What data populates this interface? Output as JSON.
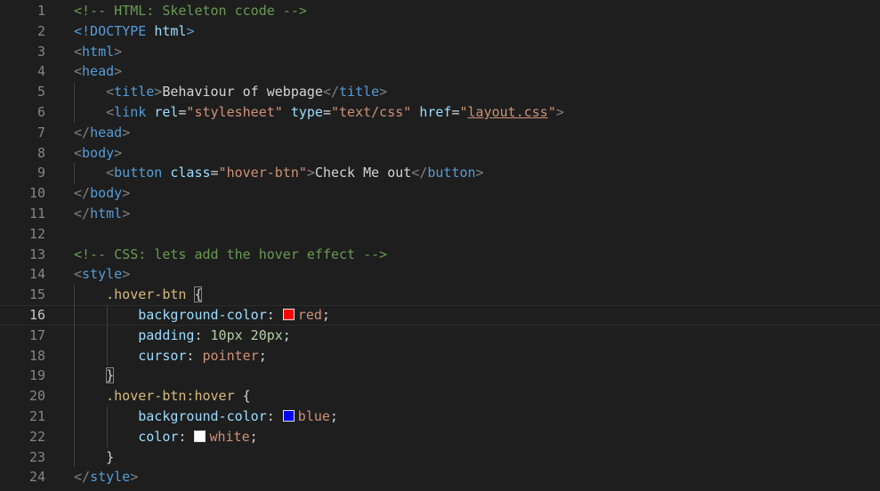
{
  "colors": {
    "background": "#1e1e1e",
    "line_number": "#858585",
    "comment": "#6a9955",
    "tag": "#569cd6",
    "attribute": "#9cdcfe",
    "string": "#ce9178",
    "selector": "#d7ba7d",
    "number": "#b5cea8"
  },
  "lines": [
    {
      "n": "1",
      "tokens": [
        {
          "t": "<!-- HTML: Skeleton ccode -->",
          "k": "comment"
        }
      ]
    },
    {
      "n": "2",
      "tokens": [
        {
          "t": "<!DOCTYPE ",
          "k": "tag"
        },
        {
          "t": "html",
          "k": "attr"
        },
        {
          "t": ">",
          "k": "tag"
        }
      ]
    },
    {
      "n": "3",
      "tokens": [
        {
          "t": "<",
          "k": "punct"
        },
        {
          "t": "html",
          "k": "tag"
        },
        {
          "t": ">",
          "k": "punct"
        }
      ]
    },
    {
      "n": "4",
      "tokens": [
        {
          "t": "<",
          "k": "punct"
        },
        {
          "t": "head",
          "k": "tag"
        },
        {
          "t": ">",
          "k": "punct"
        }
      ]
    },
    {
      "n": "5",
      "indent": 1,
      "tokens": [
        {
          "t": "<",
          "k": "punct"
        },
        {
          "t": "title",
          "k": "tag"
        },
        {
          "t": ">",
          "k": "punct"
        },
        {
          "t": "Behaviour of webpage",
          "k": "text"
        },
        {
          "t": "</",
          "k": "punct"
        },
        {
          "t": "title",
          "k": "tag"
        },
        {
          "t": ">",
          "k": "punct"
        }
      ]
    },
    {
      "n": "6",
      "indent": 1,
      "tokens": [
        {
          "t": "<",
          "k": "punct"
        },
        {
          "t": "link",
          "k": "tag"
        },
        {
          "t": " ",
          "k": "text"
        },
        {
          "t": "rel",
          "k": "attr"
        },
        {
          "t": "=",
          "k": "text"
        },
        {
          "t": "\"stylesheet\"",
          "k": "str"
        },
        {
          "t": " ",
          "k": "text"
        },
        {
          "t": "type",
          "k": "attr"
        },
        {
          "t": "=",
          "k": "text"
        },
        {
          "t": "\"text/css\"",
          "k": "str"
        },
        {
          "t": " ",
          "k": "text"
        },
        {
          "t": "href",
          "k": "attr"
        },
        {
          "t": "=",
          "k": "text"
        },
        {
          "t": "\"",
          "k": "str"
        },
        {
          "t": "layout.css",
          "k": "str",
          "link": true
        },
        {
          "t": "\"",
          "k": "str"
        },
        {
          "t": ">",
          "k": "punct"
        }
      ]
    },
    {
      "n": "7",
      "tokens": [
        {
          "t": "</",
          "k": "punct"
        },
        {
          "t": "head",
          "k": "tag"
        },
        {
          "t": ">",
          "k": "punct"
        }
      ]
    },
    {
      "n": "8",
      "tokens": [
        {
          "t": "<",
          "k": "punct"
        },
        {
          "t": "body",
          "k": "tag"
        },
        {
          "t": ">",
          "k": "punct"
        }
      ]
    },
    {
      "n": "9",
      "indent": 1,
      "tokens": [
        {
          "t": "<",
          "k": "punct"
        },
        {
          "t": "button",
          "k": "tag"
        },
        {
          "t": " ",
          "k": "text"
        },
        {
          "t": "class",
          "k": "attr"
        },
        {
          "t": "=",
          "k": "text"
        },
        {
          "t": "\"hover-btn\"",
          "k": "str"
        },
        {
          "t": ">",
          "k": "punct"
        },
        {
          "t": "Check Me out",
          "k": "text"
        },
        {
          "t": "</",
          "k": "punct"
        },
        {
          "t": "button",
          "k": "tag"
        },
        {
          "t": ">",
          "k": "punct"
        }
      ]
    },
    {
      "n": "10",
      "tokens": [
        {
          "t": "</",
          "k": "punct"
        },
        {
          "t": "body",
          "k": "tag"
        },
        {
          "t": ">",
          "k": "punct"
        }
      ]
    },
    {
      "n": "11",
      "tokens": [
        {
          "t": "</",
          "k": "punct"
        },
        {
          "t": "html",
          "k": "tag"
        },
        {
          "t": ">",
          "k": "punct"
        }
      ]
    },
    {
      "n": "12",
      "tokens": []
    },
    {
      "n": "13",
      "tokens": [
        {
          "t": "<!-- CSS: lets add the hover effect -->",
          "k": "comment"
        }
      ]
    },
    {
      "n": "14",
      "tokens": [
        {
          "t": "<",
          "k": "punct"
        },
        {
          "t": "style",
          "k": "tag"
        },
        {
          "t": ">",
          "k": "punct"
        }
      ]
    },
    {
      "n": "15",
      "indent": 1,
      "tokens": [
        {
          "t": ".hover-btn ",
          "k": "sel"
        },
        {
          "t": "{",
          "k": "text",
          "match": true
        }
      ]
    },
    {
      "n": "16",
      "indent": 2,
      "current": true,
      "tokens": [
        {
          "t": "background-color",
          "k": "prop"
        },
        {
          "t": ": ",
          "k": "text"
        },
        {
          "swatch": "#ff0000"
        },
        {
          "t": "red",
          "k": "val"
        },
        {
          "t": ";",
          "k": "text"
        }
      ]
    },
    {
      "n": "17",
      "indent": 2,
      "tokens": [
        {
          "t": "padding",
          "k": "prop"
        },
        {
          "t": ": ",
          "k": "text"
        },
        {
          "t": "10px 20px",
          "k": "num"
        },
        {
          "t": ";",
          "k": "text"
        }
      ]
    },
    {
      "n": "18",
      "indent": 2,
      "tokens": [
        {
          "t": "cursor",
          "k": "prop"
        },
        {
          "t": ": ",
          "k": "text"
        },
        {
          "t": "pointer",
          "k": "val"
        },
        {
          "t": ";",
          "k": "text"
        }
      ]
    },
    {
      "n": "19",
      "indent": 1,
      "tokens": [
        {
          "t": "}",
          "k": "text",
          "match": true
        }
      ]
    },
    {
      "n": "20",
      "indent": 1,
      "tokens": [
        {
          "t": ".hover-btn:hover ",
          "k": "sel"
        },
        {
          "t": "{",
          "k": "text"
        }
      ]
    },
    {
      "n": "21",
      "indent": 2,
      "tokens": [
        {
          "t": "background-color",
          "k": "prop"
        },
        {
          "t": ": ",
          "k": "text"
        },
        {
          "swatch": "#0000ff"
        },
        {
          "t": "blue",
          "k": "val"
        },
        {
          "t": ";",
          "k": "text"
        }
      ]
    },
    {
      "n": "22",
      "indent": 2,
      "tokens": [
        {
          "t": "color",
          "k": "prop"
        },
        {
          "t": ": ",
          "k": "text"
        },
        {
          "swatch": "#ffffff"
        },
        {
          "t": "white",
          "k": "val"
        },
        {
          "t": ";",
          "k": "text"
        }
      ]
    },
    {
      "n": "23",
      "indent": 1,
      "tokens": [
        {
          "t": "}",
          "k": "text"
        }
      ]
    },
    {
      "n": "24",
      "tokens": [
        {
          "t": "</",
          "k": "punct"
        },
        {
          "t": "style",
          "k": "tag"
        },
        {
          "t": ">",
          "k": "punct"
        }
      ]
    }
  ]
}
